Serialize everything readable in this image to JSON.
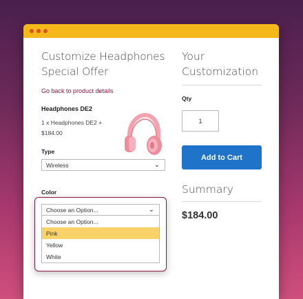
{
  "window": {
    "controls": [
      "close",
      "minimize",
      "maximize"
    ]
  },
  "product": {
    "title": "Customize Headphones Special Offer",
    "title_line1": "Customize Headphones",
    "title_line2": "Special Offer",
    "back_link": "Go back to product details",
    "name": "Headphones DE2",
    "description": "1 x Headphones DE2 + $184.00",
    "image_icon": "pink-headphones"
  },
  "type_field": {
    "label": "Type",
    "value": "Wireless"
  },
  "color_field": {
    "label": "Color",
    "value": "Choose an Option...",
    "options": [
      "Choose an Option...",
      "Pink",
      "Yellow",
      "White"
    ],
    "highlighted": "Pink"
  },
  "customization": {
    "title_line1": "Your",
    "title_line2": "Customization",
    "qty_label": "Qty",
    "qty_value": "1",
    "add_to_cart": "Add to Cart",
    "summary_label": "Summary",
    "price": "$184.00"
  },
  "colors": {
    "accent": "#f4b81b",
    "button": "#1f74c9",
    "link": "#8a1b3e",
    "highlight": "#f9d36a"
  }
}
